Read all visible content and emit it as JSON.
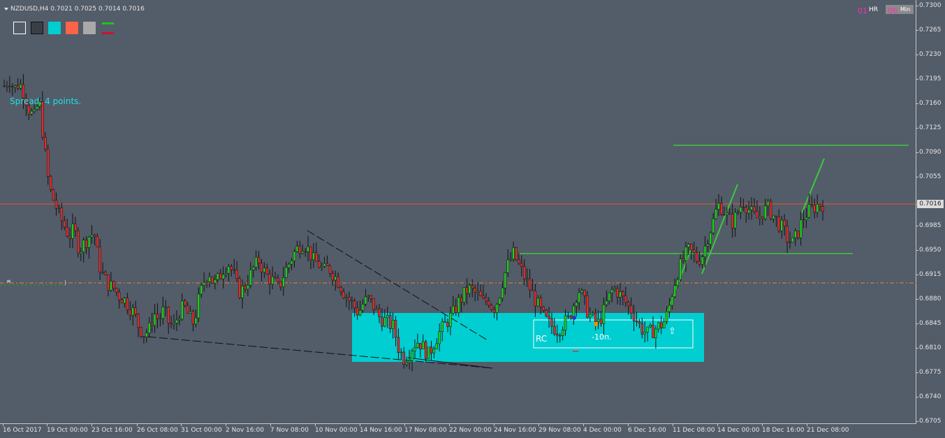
{
  "window": {
    "symbol_title": "NZDUSD,H4  0.7021 0.7025 0.7014 0.7016"
  },
  "toolbar": {
    "swatches": [
      {
        "name": "white-outline",
        "color": "#535c69",
        "border": "#ffffff"
      },
      {
        "name": "black-outline",
        "color": "#3a3f47",
        "border": "#111111"
      },
      {
        "name": "cyan",
        "color": "#00ced1",
        "border": "#00ced1"
      },
      {
        "name": "tomato",
        "color": "#ff6347",
        "border": "#ff6347"
      },
      {
        "name": "gray",
        "color": "#a9a9a9",
        "border": "#a9a9a9"
      }
    ],
    "line_green": "#22c022",
    "line_red": "#c81432"
  },
  "indicators": {
    "spread_text": "Spread: 4 points.",
    "tf_hr_num": "01",
    "tf_hr_label": "HR",
    "tf_min_num": "06",
    "tf_min_label": "Min"
  },
  "annotations": {
    "rc_label": "RC",
    "pips_label": "-10п.",
    "up_arrow": "⇧"
  },
  "price_axis": {
    "labels": [
      "0.7300",
      "0.7265",
      "0.7230",
      "0.7195",
      "0.7160",
      "0.7125",
      "0.7090",
      "0.7055",
      "0.7016",
      "0.6985",
      "0.6950",
      "0.6915",
      "0.6880",
      "0.6845",
      "0.6810",
      "0.6775",
      "0.6740",
      "0.6705"
    ],
    "current_price": "0.7016"
  },
  "time_axis": {
    "labels": [
      "16 Oct 2017",
      "19 Oct 00:00",
      "23 Oct 16:00",
      "26 Oct 08:00",
      "31 Oct 00:00",
      "2 Nov 16:00",
      "7 Nov 08:00",
      "10 Nov 00:00",
      "14 Nov 16:00",
      "17 Nov 08:00",
      "22 Nov 00:00",
      "24 Nov 16:00",
      "29 Nov 08:00",
      "4 Dec 00:00",
      "6 Dec 16:00",
      "11 Dec 08:00",
      "14 Dec 00:00",
      "18 Dec 16:00",
      "21 Dec 08:00"
    ]
  },
  "colors": {
    "background": "#535c69",
    "bull_candle": "#1fd11f",
    "bear_candle": "#e22c2c",
    "wick": "#111111",
    "zone": "#00ced1",
    "level_line": "#3ec83e",
    "current_price_line": "#e8572a",
    "dashed_level": "#e8832a"
  },
  "chart_data": {
    "type": "candlestick",
    "symbol": "NZDUSD",
    "timeframe": "H4",
    "ylim": [
      0.6705,
      0.73
    ],
    "y_ticks": [
      0.73,
      0.7265,
      0.723,
      0.7195,
      0.716,
      0.7125,
      0.709,
      0.7055,
      0.6985,
      0.695,
      0.6915,
      0.688,
      0.6845,
      0.681,
      0.6775,
      0.674,
      0.6705
    ],
    "x_labels": [
      "16 Oct 2017",
      "19 Oct 00:00",
      "23 Oct 16:00",
      "26 Oct 08:00",
      "31 Oct 00:00",
      "2 Nov 16:00",
      "7 Nov 08:00",
      "10 Nov 00:00",
      "14 Nov 16:00",
      "17 Nov 08:00",
      "22 Nov 00:00",
      "24 Nov 16:00",
      "29 Nov 08:00",
      "4 Dec 00:00",
      "6 Dec 16:00",
      "11 Dec 08:00",
      "14 Dec 00:00",
      "18 Dec 16:00",
      "21 Dec 08:00"
    ],
    "close_path": [
      0.7185,
      0.7195,
      0.718,
      0.719,
      0.7175,
      0.715,
      0.714,
      0.7165,
      0.71,
      0.704,
      0.702,
      0.7,
      0.6985,
      0.697,
      0.698,
      0.695,
      0.696,
      0.697,
      0.6975,
      0.693,
      0.691,
      0.69,
      0.6895,
      0.6885,
      0.688,
      0.687,
      0.686,
      0.684,
      0.683,
      0.6835,
      0.686,
      0.685,
      0.6865,
      0.6845,
      0.684,
      0.686,
      0.687,
      0.6855,
      0.6845,
      0.688,
      0.6905,
      0.692,
      0.69,
      0.691,
      0.6925,
      0.693,
      0.6915,
      0.689,
      0.6895,
      0.691,
      0.6925,
      0.6935,
      0.692,
      0.691,
      0.6905,
      0.6895,
      0.6915,
      0.693,
      0.6945,
      0.6955,
      0.696,
      0.695,
      0.6935,
      0.693,
      0.692,
      0.6925,
      0.6915,
      0.6905,
      0.689,
      0.688,
      0.687,
      0.686,
      0.6875,
      0.688,
      0.687,
      0.6855,
      0.685,
      0.6845,
      0.684,
      0.681,
      0.6795,
      0.68,
      0.6815,
      0.682,
      0.681,
      0.68,
      0.6815,
      0.683,
      0.684,
      0.685,
      0.686,
      0.6875,
      0.6885,
      0.6895,
      0.689,
      0.6885,
      0.6875,
      0.688,
      0.6865,
      0.688,
      0.691,
      0.693,
      0.6945,
      0.693,
      0.6915,
      0.69,
      0.6885,
      0.687,
      0.6855,
      0.6845,
      0.684,
      0.6835,
      0.6845,
      0.685,
      0.687,
      0.6895,
      0.688,
      0.686,
      0.685,
      0.6845,
      0.686,
      0.688,
      0.6895,
      0.689,
      0.688,
      0.687,
      0.686,
      0.6845,
      0.6835,
      0.683,
      0.6835,
      0.684,
      0.6845,
      0.686,
      0.6895,
      0.692,
      0.6935,
      0.695,
      0.6945,
      0.6935,
      0.6945,
      0.697,
      0.699,
      0.7015,
      0.701,
      0.6995,
      0.699,
      0.7005,
      0.702,
      0.701,
      0.7,
      0.6995,
      0.7005,
      0.701,
      0.7,
      0.699,
      0.698,
      0.6965,
      0.696,
      0.6975,
      0.6995,
      0.7005,
      0.701,
      0.7015,
      0.7016
    ],
    "levels": [
      {
        "price": 0.71,
        "color": "#3ec83e"
      },
      {
        "price": 0.6945,
        "color": "#3ec83e"
      },
      {
        "price": 0.7016,
        "color": "#e8572a"
      },
      {
        "price": 0.6903,
        "color": "#e8832a",
        "style": "dashed"
      }
    ],
    "zones": [
      {
        "from_price": 0.686,
        "to_price": 0.679,
        "color": "#00ced1"
      }
    ]
  }
}
